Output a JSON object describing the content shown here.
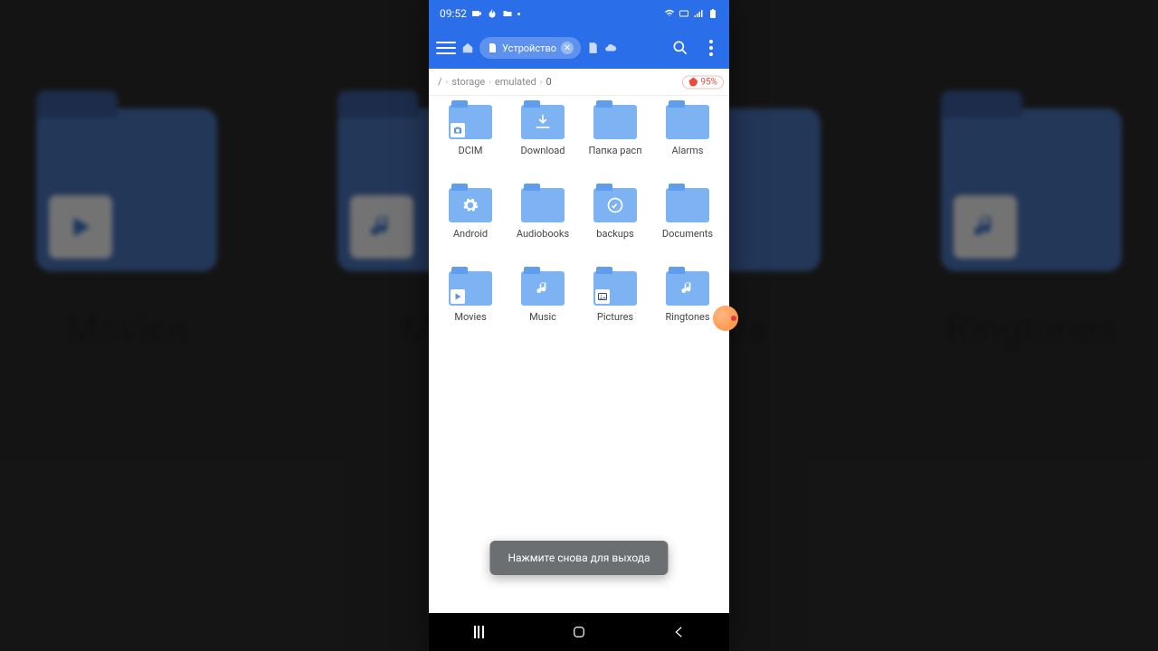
{
  "statusbar": {
    "time": "09:52"
  },
  "appbar": {
    "chip_label": "Устройство"
  },
  "path": {
    "seg1": "storage",
    "seg2": "emulated",
    "seg3": "0"
  },
  "badge": {
    "text": "95%"
  },
  "folders": [
    {
      "label": "DCIM",
      "icon": "camera",
      "mode": "corner"
    },
    {
      "label": "Download",
      "icon": "download",
      "mode": "center"
    },
    {
      "label": "Папка расп",
      "icon": "",
      "mode": "none"
    },
    {
      "label": "Alarms",
      "icon": "",
      "mode": "none"
    },
    {
      "label": "Android",
      "icon": "gear",
      "mode": "center"
    },
    {
      "label": "Audiobooks",
      "icon": "",
      "mode": "none"
    },
    {
      "label": "backups",
      "icon": "backup",
      "mode": "center"
    },
    {
      "label": "Documents",
      "icon": "",
      "mode": "none"
    },
    {
      "label": "Movies",
      "icon": "play",
      "mode": "corner"
    },
    {
      "label": "Music",
      "icon": "music",
      "mode": "center"
    },
    {
      "label": "Pictures",
      "icon": "pic",
      "mode": "corner"
    },
    {
      "label": "Ringtones",
      "icon": "music",
      "mode": "center"
    }
  ],
  "toast": {
    "message": "Нажмите снова для выхода"
  },
  "bg": {
    "left": "Movies",
    "midleft": "Mu",
    "midright": "ures",
    "right": "Ringtones"
  }
}
